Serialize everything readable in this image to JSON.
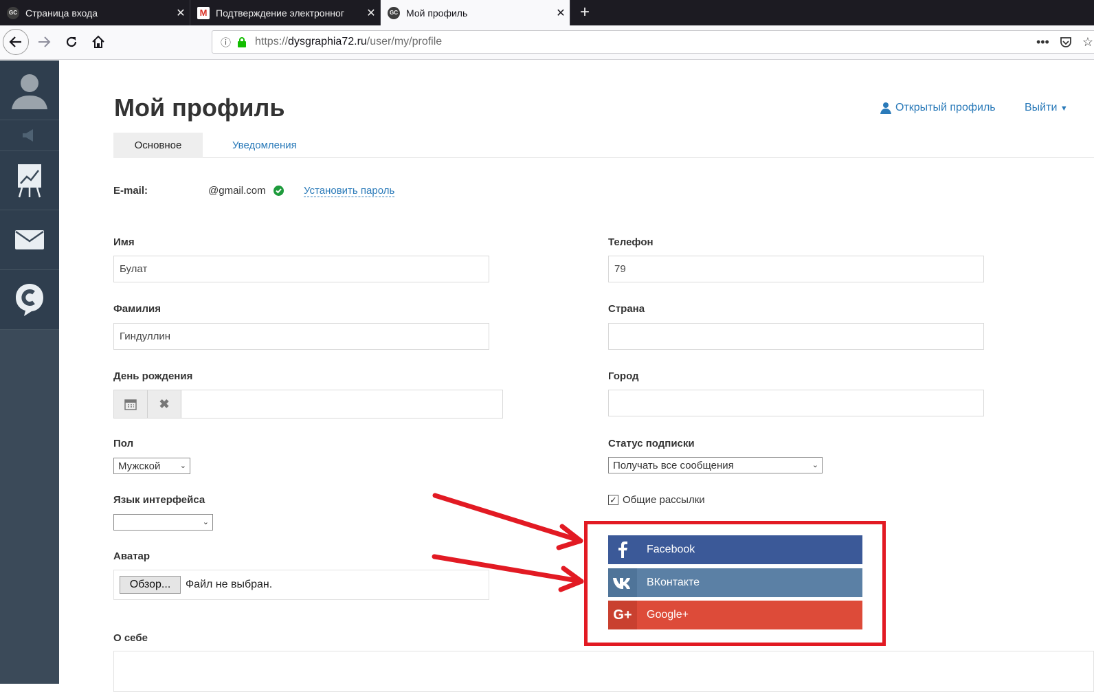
{
  "browser": {
    "tabs": [
      {
        "label": "Страница входа",
        "favicon": "GC"
      },
      {
        "label": "Подтверждение электронног",
        "favicon": "M"
      },
      {
        "label": "Мой профиль",
        "favicon": "GC"
      }
    ],
    "url": {
      "scheme": "https://",
      "host": "dysgraphia72.ru",
      "path": "/user/my/profile"
    }
  },
  "page": {
    "title": "Мой профиль",
    "open_profile_link": "Открытый профиль",
    "logout_label": "Выйти",
    "tabs": [
      {
        "label": "Основное"
      },
      {
        "label": "Уведомления"
      }
    ]
  },
  "email": {
    "label": "E-mail:",
    "value": "@gmail.com",
    "set_password_link": "Установить пароль"
  },
  "form": {
    "name_label": "Имя",
    "name_value": "Булат",
    "surname_label": "Фамилия",
    "surname_value": "Гиндуллин",
    "birthday_label": "День рождения",
    "gender_label": "Пол",
    "gender_value": "Мужской",
    "language_label": "Язык интерфейса",
    "language_value": "",
    "avatar_label": "Аватар",
    "avatar_button": "Обзор...",
    "avatar_status": "Файл не выбран.",
    "about_label": "О себе",
    "phone_label": "Телефон",
    "phone_value": "79",
    "country_label": "Страна",
    "country_value": "",
    "city_label": "Город",
    "city_value": "",
    "subscription_label": "Статус подписки",
    "subscription_value": "Получать все сообщения",
    "newsletter_label": "Общие рассылки"
  },
  "social": [
    {
      "label": "Facebook",
      "color": "#3b5998",
      "icon_color": "#3b5998"
    },
    {
      "label": "ВКонтакте",
      "color": "#5b80a5",
      "icon_color": "#4f7499"
    },
    {
      "label": "Google+",
      "color": "#dd4b39",
      "icon_color": "#c9402f"
    }
  ],
  "colors": {
    "annotation": "#e21a23",
    "link": "#2a7ab9",
    "sidebar": "#3b4a59"
  }
}
